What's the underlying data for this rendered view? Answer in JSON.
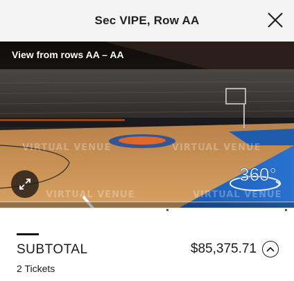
{
  "header": {
    "title": "Sec VIPE, Row AA"
  },
  "view": {
    "label": "View from rows AA – AA",
    "badge_text": "360°",
    "watermark_text": "VIRTUAL VENUE"
  },
  "summary": {
    "subtotal_label": "SUBTOTAL",
    "subtotal_amount": "$85,375.71",
    "tickets": "2 Tickets"
  },
  "icons": {
    "close": "close-icon",
    "expand": "expand-icon",
    "chevron": "chevron-up-icon",
    "badge": "360-view-icon"
  },
  "colors": {
    "court_wood": "#c9914f",
    "court_blue": "#1e5fb6",
    "header_bg": "#f4f4f4"
  }
}
